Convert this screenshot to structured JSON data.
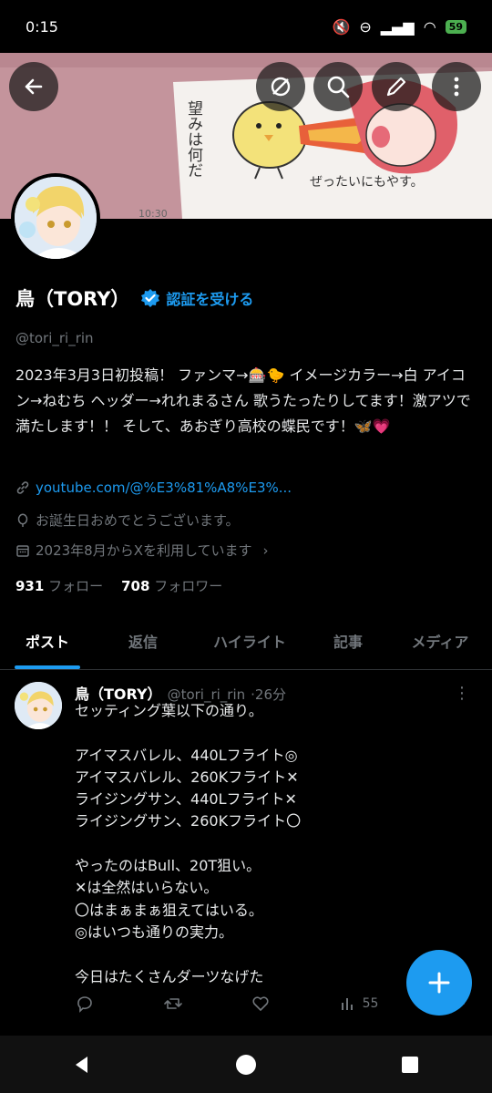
{
  "status": {
    "time": "0:15",
    "battery": "59"
  },
  "banner": {
    "text_left": "望みは何だ",
    "text_right": "ぜったいにもやす。",
    "timestamp": "10:30"
  },
  "header_buttons": {
    "back": "back-arrow-icon",
    "hide": "eye-off-icon",
    "search": "search-icon",
    "edit": "pencil-icon",
    "more": "more-vertical-icon"
  },
  "profile": {
    "name": "鳥（TORY）",
    "verify_label": "認証を受ける",
    "handle": "@tori_ri_rin",
    "bio": "2023年3月3日初投稿！ ファンマ→🎰🐤 イメージカラー→白 アイコン→ねむち ヘッダー→れれまるさん 歌うたったりしてます！激アツで満たします！！ そして、あおぎり高校の蝶民です！🦋💗",
    "link": "youtube.com/@%E3%81%A8%E3%...",
    "birthday": "お誕生日おめでとうございます。",
    "joined": "2023年8月からXを利用しています",
    "following_count": "931",
    "following_label": "フォロー",
    "followers_count": "708",
    "followers_label": "フォロワー"
  },
  "tabs": [
    "ポスト",
    "返信",
    "ハイライト",
    "記事",
    "メディア"
  ],
  "post": {
    "name": "鳥（TORY）",
    "handle": "@tori_ri_rin",
    "time": "·26分",
    "text": "セッティング葉以下の通り。\n\nアイマスバレル、440Lフライト◎\nアイマスバレル、260Kフライト✕\nライジングサン、440Lフライト✕\nライジングサン、260Kフライト〇\n\nやったのはBull、20T狙い。\n✕は全然はいらない。\n〇はまぁまぁ狙えてはいる。\n◎はいつも通りの実力。\n\n今日はたくさんダーツなげた",
    "views": "55"
  },
  "colors": {
    "accent": "#1d9bf0",
    "background": "#000000",
    "muted": "#71767b",
    "banner": "#c4949c"
  }
}
